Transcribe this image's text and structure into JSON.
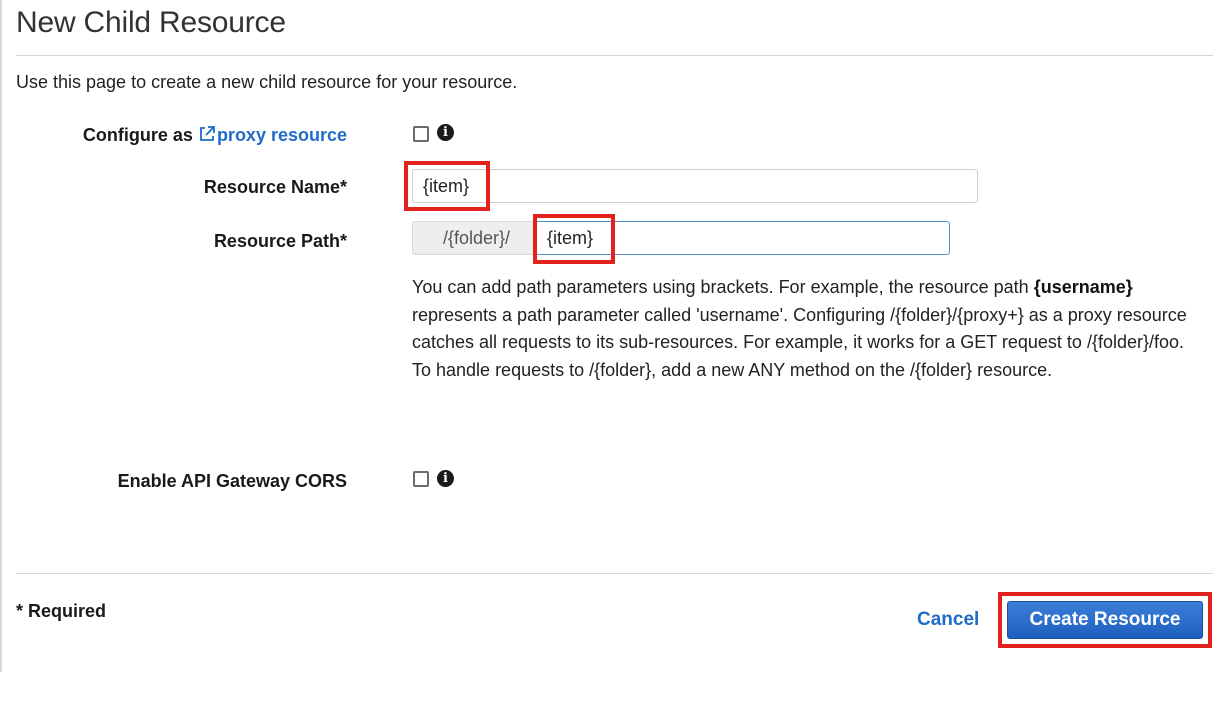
{
  "page": {
    "title": "New Child Resource",
    "intro": "Use this page to create a new child resource for your resource."
  },
  "form": {
    "proxy": {
      "label_prefix": "Configure as ",
      "link_text": "proxy resource",
      "icon": "external-link-icon",
      "checked": false,
      "info_icon": "info-icon"
    },
    "resource_name": {
      "label": "Resource Name*",
      "value": "{item}"
    },
    "resource_path": {
      "label": "Resource Path*",
      "prefix": "/{folder}/",
      "value": "{item}"
    },
    "help": {
      "part1": "You can add path parameters using brackets. For example, the resource path ",
      "bold": "{username}",
      "part2": " represents a path parameter called 'username'. Configuring /{folder}/{proxy+} as a proxy resource catches all requests to its sub-resources. For example, it works for a GET request to /{folder}/foo. To handle requests to /{folder}, add a new ANY method on the /{folder} resource."
    },
    "cors": {
      "label": "Enable API Gateway CORS",
      "checked": false,
      "info_icon": "info-icon"
    }
  },
  "footer": {
    "required_note": "* Required",
    "cancel_label": "Cancel",
    "create_label": "Create Resource"
  },
  "colors": {
    "link": "#1f6cc7",
    "primary_button": "#2a6fce",
    "highlight": "#e3211d"
  }
}
